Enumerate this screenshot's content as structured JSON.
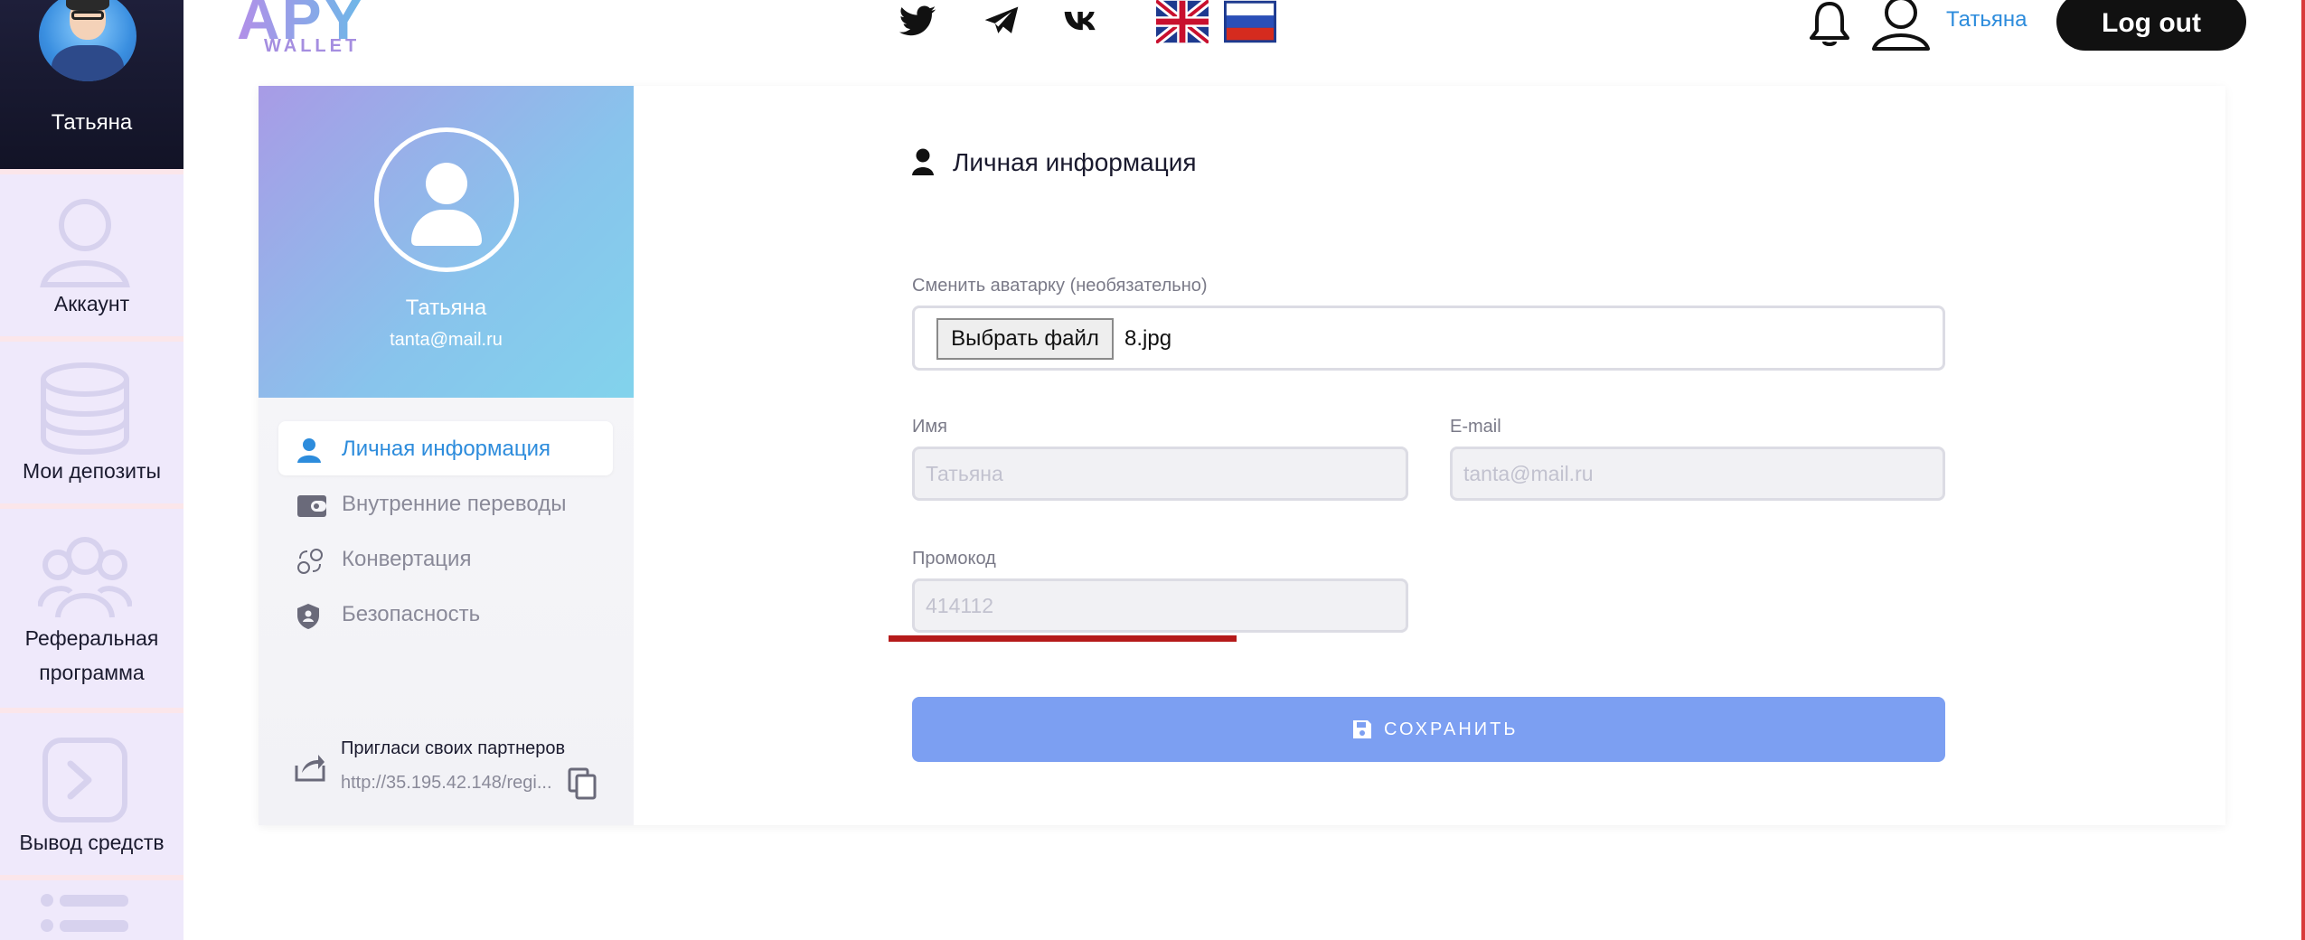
{
  "sidebar": {
    "user_name": "Татьяна",
    "items": [
      {
        "label": "Аккаунт",
        "icon": "user-icon"
      },
      {
        "label": "Мои депозиты",
        "icon": "database-icon"
      },
      {
        "label": "Реферальная",
        "label2": "программа",
        "icon": "users-icon"
      },
      {
        "label": "Вывод средств",
        "icon": "terminal-icon"
      },
      {
        "label": "",
        "icon": "list-icon"
      }
    ]
  },
  "header": {
    "logo": "APY",
    "logo_sub": "WALLET",
    "social_icons": [
      "twitter-icon",
      "telegram-icon",
      "vk-icon"
    ],
    "languages": [
      "en",
      "ru"
    ],
    "user_name": "Татьяна",
    "logout_label": "Log out"
  },
  "profile": {
    "name": "Татьяна",
    "email": "tanta@mail.ru",
    "menu": [
      {
        "label": "Личная информация",
        "icon": "user-icon",
        "active": true
      },
      {
        "label": "Внутренние переводы",
        "icon": "wallet-icon",
        "active": false
      },
      {
        "label": "Конвертация",
        "icon": "exchange-icon",
        "active": false
      },
      {
        "label": "Безопасность",
        "icon": "shield-icon",
        "active": false
      }
    ],
    "invite_title": "Пригласи своих партнеров",
    "invite_link": "http://35.195.42.148/regi..."
  },
  "form": {
    "title": "Личная информация",
    "avatar_label": "Сменить аватарку (необязательно)",
    "file_button": "Выбрать файл",
    "file_name": "8.jpg",
    "name_label": "Имя",
    "name_value": "Татьяна",
    "email_label": "E-mail",
    "email_value": "tanta@mail.ru",
    "promo_label": "Промокод",
    "promo_value": "414112",
    "save_label": "СОХРАНИТЬ"
  },
  "colors": {
    "accent": "#2d8cdc",
    "save_button": "#7c9ff2",
    "sidebar_bg": "#ece6f8",
    "underline": "#b51a1a"
  }
}
